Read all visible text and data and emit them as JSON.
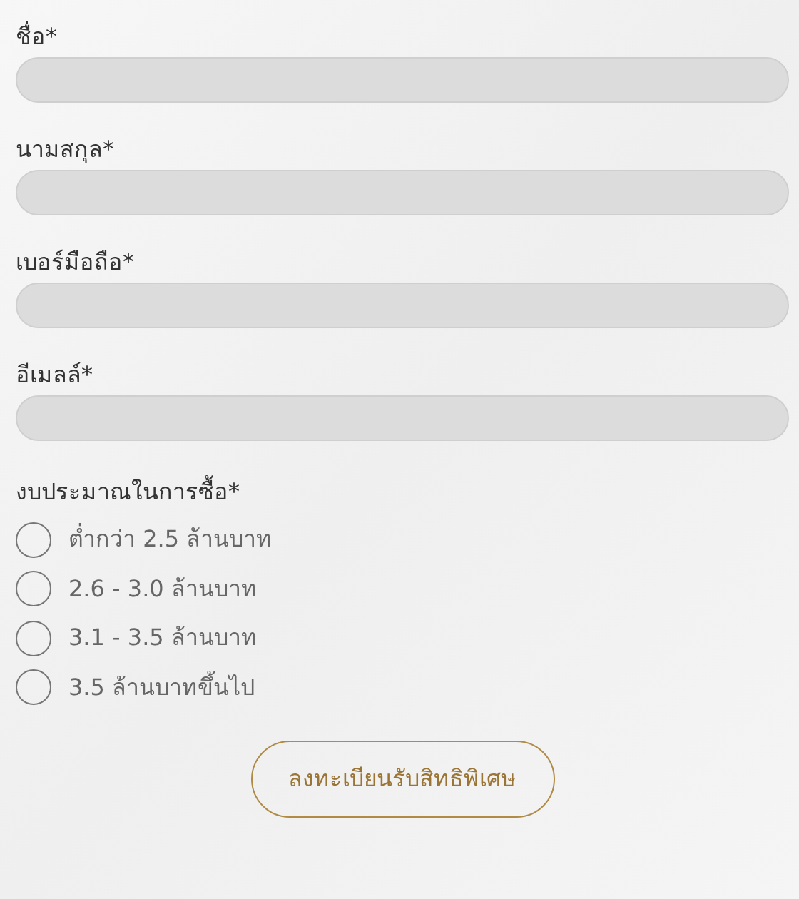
{
  "fields": [
    {
      "label": "ชื่อ*"
    },
    {
      "label": "นามสกุล*"
    },
    {
      "label": "เบอร์มือถือ*"
    },
    {
      "label": "อีเมลล์*"
    }
  ],
  "budget": {
    "label": "งบประมาณในการซื้อ*",
    "options": [
      {
        "label": "ต่ำกว่า 2.5 ล้านบาท",
        "selected": false
      },
      {
        "label": "2.6 - 3.0 ล้านบาท",
        "selected": false
      },
      {
        "label": "3.1 - 3.5 ล้านบาท",
        "selected": false
      },
      {
        "label": "3.5 ล้านบาทขึ้นไป",
        "selected": false
      }
    ]
  },
  "submit": {
    "label": "ลงทะเบียนรับสิทธิพิเศษ"
  }
}
